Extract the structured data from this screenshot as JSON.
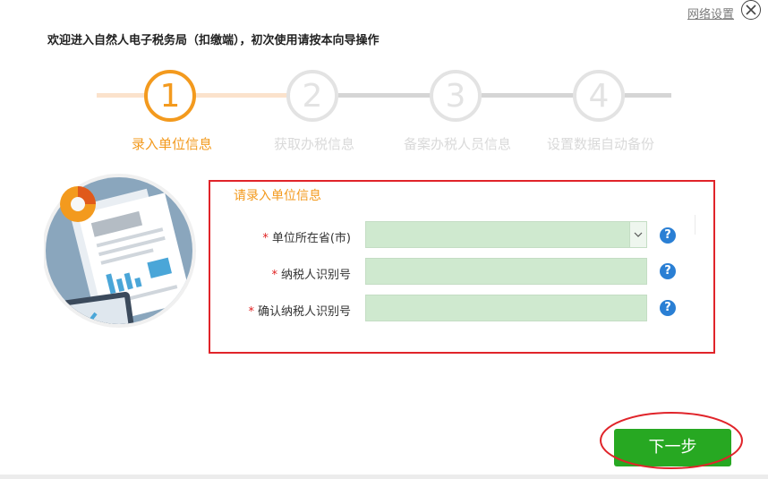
{
  "header": {
    "network_settings": "网络设置",
    "welcome": "欢迎进入自然人电子税务局（扣缴端），初次使用请按本向导操作"
  },
  "steps": [
    {
      "number": "1",
      "label": "录入单位信息",
      "state": "active"
    },
    {
      "number": "2",
      "label": "获取办税信息",
      "state": "inactive"
    },
    {
      "number": "3",
      "label": "备案办税人员信息",
      "state": "inactive"
    },
    {
      "number": "4",
      "label": "设置数据自动备份",
      "state": "inactive"
    }
  ],
  "form": {
    "title": "请录入单位信息",
    "required_mark": "*",
    "fields": [
      {
        "label": "单位所在省(市)",
        "type": "select",
        "value": ""
      },
      {
        "label": "纳税人识别号",
        "type": "text",
        "value": ""
      },
      {
        "label": "确认纳税人识别号",
        "type": "text",
        "value": ""
      }
    ],
    "help_glyph": "?"
  },
  "footer": {
    "next_label": "下一步"
  },
  "colors": {
    "accent_orange": "#f39a1e",
    "inactive_gray": "#e3e3e3",
    "field_green": "#cfe9cf",
    "button_green": "#27a822",
    "annotation_red": "#e0242a",
    "help_blue": "#2a7fd4"
  }
}
